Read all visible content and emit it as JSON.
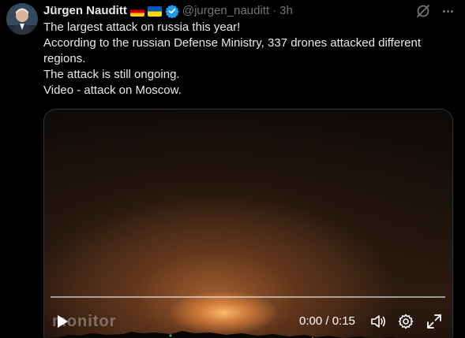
{
  "tweet": {
    "author": {
      "display_name": "Jürgen Nauditt",
      "flags": [
        "flag-de-icon",
        "flag-ua-icon"
      ],
      "verified": true,
      "handle": "@jurgen_nauditt",
      "separator": "·",
      "time": "3h"
    },
    "text_lines": [
      "The largest attack on russia this year!",
      "According to the russian Defense Ministry, 337 drones attacked different regions.",
      "The attack is still ongoing.",
      "Video - attack on Moscow."
    ],
    "media": {
      "watermark": "monitor",
      "progress": 0.0,
      "time_readout": "0:00 / 0:15",
      "controls": [
        "play-icon",
        "volume-icon",
        "settings-gear-icon",
        "fullscreen-icon"
      ]
    },
    "actions": [
      "grok-icon",
      "more-icon"
    ]
  },
  "colors": {
    "background": "#000000",
    "text": "#e7e9ea",
    "muted": "#71767b",
    "verified_blue": "#1d9bf0"
  }
}
